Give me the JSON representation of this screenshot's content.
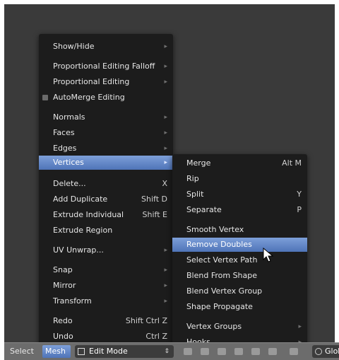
{
  "main_menu": {
    "items": [
      {
        "label": "Show/Hide",
        "shortcut": "",
        "submenu": true
      },
      {
        "label": "Proportional Editing Falloff",
        "shortcut": "",
        "submenu": true
      },
      {
        "label": "Proportional Editing",
        "shortcut": "",
        "submenu": true
      },
      {
        "label": "AutoMerge Editing",
        "shortcut": "",
        "checkbox": true
      },
      {
        "label": "Normals",
        "shortcut": "",
        "submenu": true
      },
      {
        "label": "Faces",
        "shortcut": "",
        "submenu": true
      },
      {
        "label": "Edges",
        "shortcut": "",
        "submenu": true
      },
      {
        "label": "Vertices",
        "shortcut": "",
        "submenu": true,
        "highlighted": true
      },
      {
        "label": "Delete...",
        "shortcut": "X"
      },
      {
        "label": "Add Duplicate",
        "shortcut": "Shift D"
      },
      {
        "label": "Extrude Individual",
        "shortcut": "Shift E"
      },
      {
        "label": "Extrude Region",
        "shortcut": ""
      },
      {
        "label": "UV Unwrap...",
        "shortcut": "",
        "submenu": true
      },
      {
        "label": "Snap",
        "shortcut": "",
        "submenu": true
      },
      {
        "label": "Mirror",
        "shortcut": "",
        "submenu": true
      },
      {
        "label": "Transform",
        "shortcut": "",
        "submenu": true
      },
      {
        "label": "Redo",
        "shortcut": "Shift Ctrl Z"
      },
      {
        "label": "Undo",
        "shortcut": "Ctrl Z"
      }
    ]
  },
  "vertices_submenu": {
    "items": [
      {
        "label": "Merge",
        "shortcut": "Alt M"
      },
      {
        "label": "Rip",
        "shortcut": ""
      },
      {
        "label": "Split",
        "shortcut": "Y"
      },
      {
        "label": "Separate",
        "shortcut": "P"
      },
      {
        "label": "Smooth Vertex",
        "shortcut": ""
      },
      {
        "label": "Remove Doubles",
        "shortcut": "",
        "highlighted": true
      },
      {
        "label": "Select Vertex Path",
        "shortcut": ""
      },
      {
        "label": "Blend From Shape",
        "shortcut": ""
      },
      {
        "label": "Blend Vertex Group",
        "shortcut": ""
      },
      {
        "label": "Shape Propagate",
        "shortcut": ""
      },
      {
        "label": "Vertex Groups",
        "shortcut": "",
        "submenu": true
      },
      {
        "label": "Hooks",
        "shortcut": "",
        "submenu": true
      }
    ]
  },
  "header": {
    "select_label": "Select",
    "mesh_label": "Mesh",
    "mode_label": "Edit Mode",
    "orientation_label": "Glob"
  },
  "colors": {
    "menu_bg": "#1c1c1c",
    "highlight": "#5a7fc4",
    "viewport_bg": "#3a3a3a",
    "header_bg": "#6c6c6c"
  }
}
